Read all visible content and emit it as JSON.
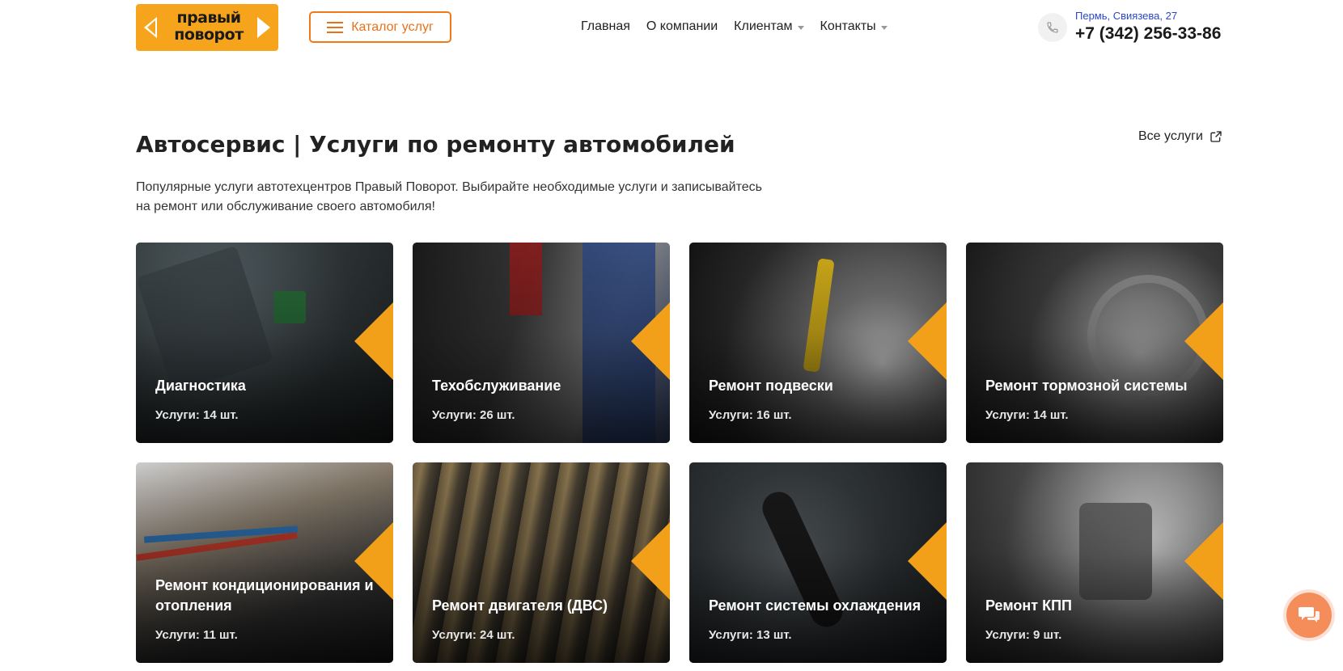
{
  "header": {
    "logo_text_line1": "правый",
    "logo_text_line2": "поворот",
    "catalog_label": "Каталог услуг",
    "nav": [
      {
        "label": "Главная",
        "has_dropdown": false
      },
      {
        "label": "О компании",
        "has_dropdown": false
      },
      {
        "label": "Клиентам",
        "has_dropdown": true
      },
      {
        "label": "Контакты",
        "has_dropdown": true
      }
    ],
    "address": "Пермь, Свиязева, 27",
    "phone": "+7 (342) 256-33-86"
  },
  "section": {
    "title": "Автосервис | Услуги по ремонту автомобилей",
    "all_services_label": "Все услуги",
    "description": "Популярные услуги автотехцентров Правый Поворот. Выбирайте необходимые услуги и записывайтесь на ремонт или обслуживание своего автомобиля!"
  },
  "cards": [
    {
      "title": "Диагностика",
      "count": "Услуги: 14 шт."
    },
    {
      "title": "Техобслуживание",
      "count": "Услуги: 26 шт."
    },
    {
      "title": "Ремонт подвески",
      "count": "Услуги: 16 шт."
    },
    {
      "title": "Ремонт тормозной системы",
      "count": "Услуги: 14 шт."
    },
    {
      "title": "Ремонт кондиционирования и отопления",
      "count": "Услуги: 11 шт."
    },
    {
      "title": "Ремонт двигателя (ДВС)",
      "count": "Услуги: 24 шт."
    },
    {
      "title": "Ремонт системы охлаждения",
      "count": "Услуги: 13 шт."
    },
    {
      "title": "Ремонт КПП",
      "count": "Услуги: 9 шт."
    }
  ],
  "colors": {
    "brand_yellow": "#f7a41d",
    "accent_orange": "#f07a1a",
    "address_blue": "#2b46c8",
    "chat_button": "#f58d5a"
  },
  "icons": [
    "phone-icon",
    "external-link-icon",
    "chat-icon",
    "menu-icon",
    "caret-down-icon"
  ]
}
